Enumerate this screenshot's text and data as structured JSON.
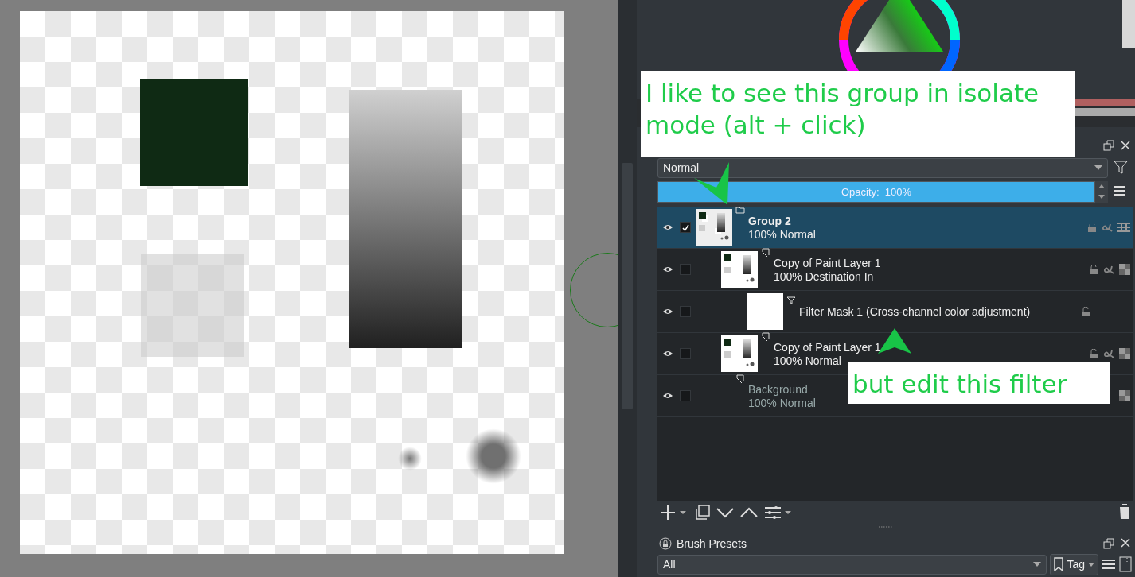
{
  "layers_panel": {
    "blend_mode": "Normal",
    "opacity": {
      "label": "Opacity:  100%",
      "level": 1.0
    },
    "layers": [
      {
        "kind": "group",
        "name": "Group 2",
        "mode": "100% Normal",
        "visible": true,
        "selected": true,
        "dimmed": false,
        "children": [
          {
            "kind": "paint",
            "name": "Copy of Paint Layer 1",
            "mode": "100% Destination In",
            "visible": true,
            "selected": false,
            "dimmed": false,
            "children": [
              {
                "kind": "filter_mask",
                "name": "Filter Mask 1 (Cross-channel color adjustment)",
                "visible": true,
                "selected": false,
                "dimmed": false
              }
            ]
          },
          {
            "kind": "paint",
            "name": "Copy of Paint Layer 1",
            "mode": "100% Normal",
            "visible": true,
            "selected": false,
            "dimmed": false
          }
        ]
      },
      {
        "kind": "paint_nothumb",
        "name": "Background",
        "mode": "100% Normal",
        "visible": true,
        "selected": false,
        "dimmed": true
      }
    ]
  },
  "brush_presets": {
    "title": "Brush Presets",
    "filter": "All",
    "tag_button": "Tag"
  },
  "annotations": [
    {
      "text": "I like to see this group in isolate mode (alt + click)"
    },
    {
      "text": "but edit this filter"
    }
  ]
}
